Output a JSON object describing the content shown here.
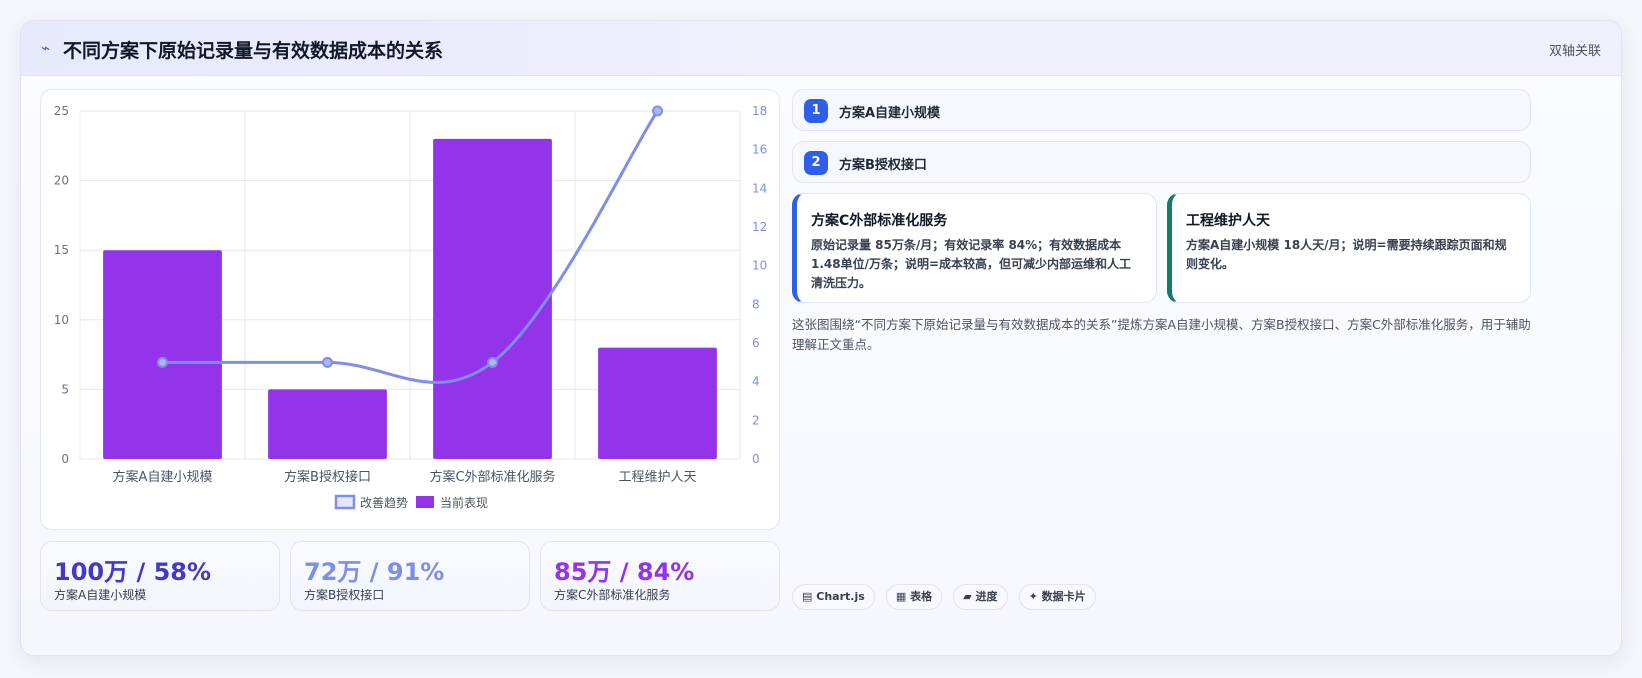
{
  "header": {
    "icon": "wave-icon",
    "icon_glyph": "⌁",
    "title": "不同方案下原始记录量与有效数据成本的关系",
    "tag": "双轴关联"
  },
  "chart_data": {
    "type": "bar",
    "categories": [
      "方案A自建小规模",
      "方案B授权接口",
      "方案C外部标准化服务",
      "工程维护人天"
    ],
    "series": [
      {
        "name": "当前表现",
        "type": "bar",
        "axis": "left",
        "color": "#9333ea",
        "values": [
          15,
          5,
          23,
          8
        ]
      },
      {
        "name": "改善趋势",
        "type": "line",
        "axis": "right",
        "color": "#7f8ee8",
        "values": [
          5,
          5,
          5,
          18
        ]
      }
    ],
    "y_left": {
      "ylim": [
        0,
        25
      ],
      "ticks": [
        0,
        5,
        10,
        15,
        20,
        25
      ]
    },
    "y_right": {
      "ylim": [
        0,
        18
      ],
      "ticks": [
        0,
        2,
        4,
        6,
        8,
        10,
        12,
        14,
        16,
        18
      ]
    },
    "legend": {
      "placement": "bottom",
      "items": [
        "改善趋势",
        "当前表现"
      ]
    },
    "grid": true
  },
  "stats": [
    {
      "value": "100万 / 58%",
      "label": "方案A自建小规模",
      "color": "#4338ca"
    },
    {
      "value": "72万 / 91%",
      "label": "方案B授权接口",
      "color": "#7f8ee8"
    },
    {
      "value": "85万 / 84%",
      "label": "方案C外部标准化服务",
      "color": "#9333ea"
    }
  ],
  "steps": [
    {
      "num": "1",
      "text": "方案A自建小规模"
    },
    {
      "num": "2",
      "text": "方案B授权接口"
    }
  ],
  "notes": [
    {
      "title": "方案C外部标准化服务",
      "body": "原始记录量 85万条/月；有效记录率 84%；有效数据成本 1.48单位/万条；说明=成本较高，但可减少内部运维和人工清洗压力。",
      "accent": "#2f5fe8"
    },
    {
      "title": "工程维护人天",
      "body": "方案A自建小规模 18人天/月；说明=需要持续跟踪页面和规则变化。",
      "accent": "#147a6a"
    }
  ],
  "description": "这张图围绕“不同方案下原始记录量与有效数据成本的关系”提炼方案A自建小规模、方案B授权接口、方案C外部标准化服务，用于辅助理解正文重点。",
  "tags": [
    {
      "icon": "chart-icon",
      "glyph": "▤",
      "label": "Chart.js"
    },
    {
      "icon": "table-icon",
      "glyph": "▦",
      "label": "表格"
    },
    {
      "icon": "progress-icon",
      "glyph": "▰",
      "label": "进度"
    },
    {
      "icon": "sparkle-icon",
      "glyph": "✦",
      "label": "数据卡片"
    }
  ]
}
